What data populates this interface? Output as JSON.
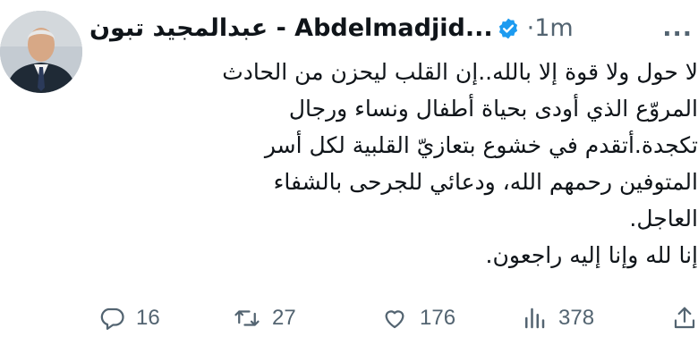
{
  "author": {
    "display_name": "عبدالمجيد تبون - Abdelmadjid...",
    "verified": true,
    "separator": "·",
    "time": "1m",
    "more_label": "..."
  },
  "tweet": {
    "lines": [
      "لا حول ولا قوة إلا بالله..إن القلب ليحزن من الحادث",
      "المروّع الذي أودى بحياة أطفال ونساء ورجال",
      "تكجدة.أتقدم في خشوع بتعازيّ القلبية لكل أسر",
      "المتوفين رحمهم الله، ودعائي للجرحى بالشفاء",
      "العاجل.",
      "إنا لله وإنا إليه راجعون."
    ]
  },
  "actions": {
    "replies": "16",
    "retweets": "27",
    "likes": "176",
    "views": "378"
  },
  "colors": {
    "text": "#0f1419",
    "secondary": "#536471",
    "verified": "#1d9bf0",
    "background": "#ffffff"
  },
  "icons": [
    "verified-badge-icon",
    "reply-icon",
    "retweet-icon",
    "like-icon",
    "views-icon",
    "share-icon"
  ]
}
